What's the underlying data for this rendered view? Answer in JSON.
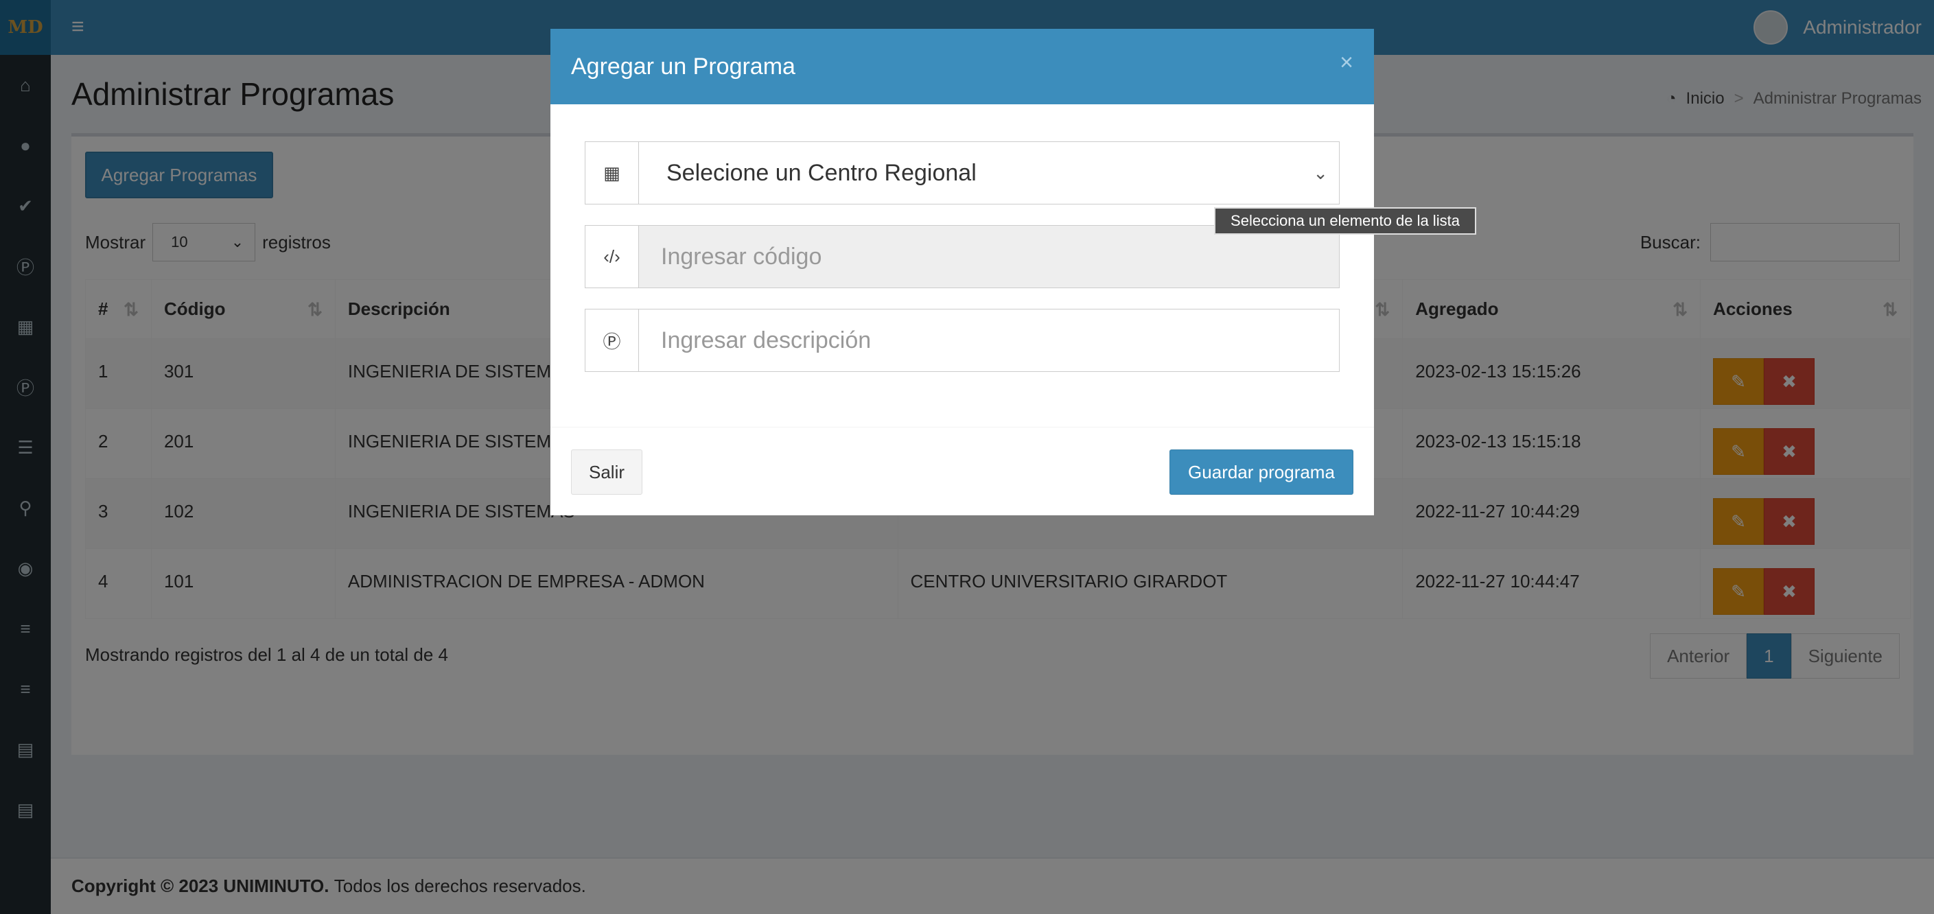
{
  "brand": {
    "logo_text": "MD"
  },
  "sidebar": {
    "icons": [
      "home-icon",
      "user-icon",
      "check-icon",
      "p-circle-icon",
      "grid-icon",
      "p-circle-icon",
      "list-icon",
      "search-icon",
      "eye-icon",
      "list-ul-icon",
      "list-ul-icon",
      "book-icon",
      "book-icon"
    ]
  },
  "header": {
    "user_name": "Administrador"
  },
  "page": {
    "title": "Administrar Programas"
  },
  "breadcrumb": {
    "home": "Inicio",
    "separator": ">",
    "current": "Administrar Programas"
  },
  "toolbar": {
    "add_label": "Agregar Programas"
  },
  "datatable": {
    "show_label": "Mostrar",
    "show_value": "10",
    "records_label": "registros",
    "search_label": "Buscar:",
    "columns": [
      "#",
      "Código",
      "Descripción",
      "",
      "Agregado",
      "Acciones"
    ],
    "rows": [
      {
        "num": "1",
        "codigo": "301",
        "descripcion": "INGENIERIA DE SISTEMAS",
        "centro": "",
        "agregado": "2023-02-13 15:15:26"
      },
      {
        "num": "2",
        "codigo": "201",
        "descripcion": "INGENIERIA DE SISTEMAS",
        "centro": "",
        "agregado": "2023-02-13 15:15:18"
      },
      {
        "num": "3",
        "codigo": "102",
        "descripcion": "INGENIERIA DE SISTEMAS",
        "centro": "",
        "agregado": "2022-11-27 10:44:29"
      },
      {
        "num": "4",
        "codigo": "101",
        "descripcion": "ADMINISTRACION DE EMPRESA - ADMON",
        "centro": "CENTRO UNIVERSITARIO GIRARDOT",
        "agregado": "2022-11-27 10:44:47"
      }
    ],
    "info": "Mostrando registros del 1 al 4 de un total de 4",
    "pagination": {
      "prev": "Anterior",
      "current": "1",
      "next": "Siguiente"
    }
  },
  "footer": {
    "copyright": "Copyright © 2023 UNIMINUTO.",
    "rights": "Todos los derechos reservados."
  },
  "modal": {
    "title": "Agregar un Programa",
    "close": "×",
    "centro_select": "Selecione un Centro Regional",
    "codigo_placeholder": "Ingresar código",
    "descripcion_placeholder": "Ingresar descripción",
    "exit_label": "Salir",
    "save_label": "Guardar programa"
  },
  "tooltip": "Selecciona un elemento de la lista",
  "colors": {
    "primary": "#3c8dbc",
    "warning": "#f39c12",
    "danger": "#dd4b39",
    "sidebar": "#222d32"
  }
}
